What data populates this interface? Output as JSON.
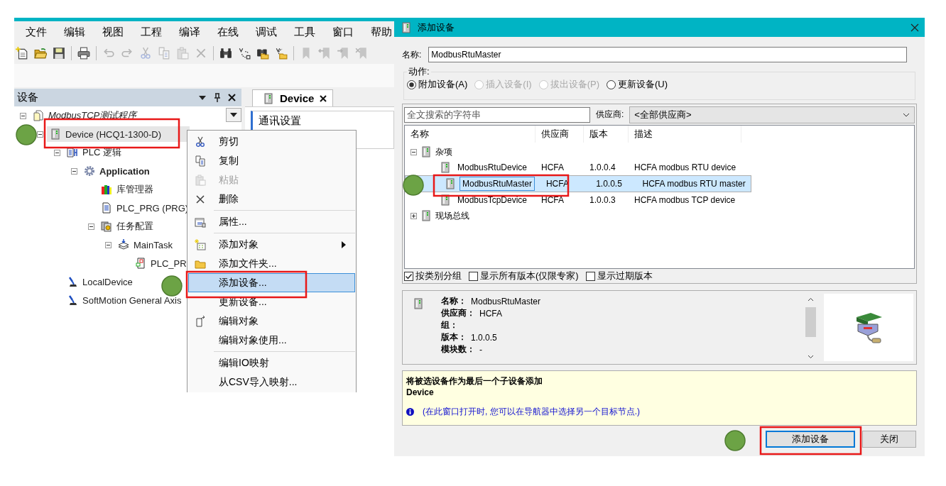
{
  "ide": {
    "menu": [
      "文件",
      "编辑",
      "视图",
      "工程",
      "编译",
      "在线",
      "调试",
      "工具",
      "窗口",
      "帮助"
    ],
    "toolbar": [
      {
        "kind": "new",
        "disabled": false
      },
      {
        "kind": "open",
        "disabled": false
      },
      {
        "kind": "save",
        "disabled": false
      },
      {
        "kind": "separator"
      },
      {
        "kind": "print",
        "disabled": false
      },
      {
        "kind": "separator"
      },
      {
        "kind": "undo",
        "disabled": true
      },
      {
        "kind": "redo",
        "disabled": true
      },
      {
        "kind": "cut",
        "disabled": true
      },
      {
        "kind": "copy",
        "disabled": true
      },
      {
        "kind": "paste",
        "disabled": true
      },
      {
        "kind": "delete",
        "disabled": true
      },
      {
        "kind": "separator"
      },
      {
        "kind": "find",
        "disabled": false
      },
      {
        "kind": "replace",
        "disabled": false
      },
      {
        "kind": "find-files",
        "disabled": false
      },
      {
        "kind": "replace-files",
        "disabled": false
      },
      {
        "kind": "separator"
      },
      {
        "kind": "bookmark",
        "disabled": true
      },
      {
        "kind": "bookmark-prev",
        "disabled": true
      },
      {
        "kind": "bookmark-next",
        "disabled": true
      },
      {
        "kind": "bookmark-clear",
        "disabled": true
      }
    ],
    "devices_pane": {
      "title": "设备",
      "tree": [
        {
          "kind": "project",
          "label": "ModbusTCP测试程序",
          "expanded": true,
          "selected": false,
          "children": [
            {
              "kind": "device",
              "label": "Device (HCQ1-1300-D)",
              "expanded": true,
              "selected": true,
              "children": [
                {
                  "kind": "plc-logic",
                  "label": "PLC 逻辑",
                  "expanded": true,
                  "selected": false,
                  "children": [
                    {
                      "kind": "application",
                      "label": "Application",
                      "expanded": true,
                      "selected": false,
                      "children": [
                        {
                          "kind": "library",
                          "label": "库管理器",
                          "selected": false
                        },
                        {
                          "kind": "pou",
                          "label": "PLC_PRG (PRG)",
                          "selected": false
                        },
                        {
                          "kind": "task-config",
                          "label": "任务配置",
                          "expanded": true,
                          "selected": false,
                          "children": [
                            {
                              "kind": "task",
                              "label": "MainTask",
                              "expanded": true,
                              "selected": false,
                              "children": [
                                {
                                  "kind": "task-call",
                                  "label": "PLC_PR",
                                  "selected": false
                                }
                              ]
                            }
                          ]
                        }
                      ]
                    }
                  ]
                },
                {
                  "kind": "axis",
                  "label": "LocalDevice",
                  "selected": false
                },
                {
                  "kind": "axis",
                  "label": "SoftMotion General Axis",
                  "selected": false
                }
              ]
            }
          ]
        }
      ]
    },
    "editor": {
      "tab": "Device",
      "heading": "通讯设置"
    },
    "context_menu": [
      {
        "kind": "cut",
        "label": "剪切",
        "disabled": false,
        "selected": false,
        "submenu": false
      },
      {
        "kind": "copy",
        "label": "复制",
        "disabled": false,
        "selected": false,
        "submenu": false
      },
      {
        "kind": "paste",
        "label": "粘贴",
        "disabled": true,
        "selected": false,
        "submenu": false
      },
      {
        "kind": "delete",
        "label": "删除",
        "disabled": false,
        "selected": false,
        "submenu": false
      },
      {
        "kind": "separator"
      },
      {
        "kind": "properties",
        "label": "属性...",
        "disabled": false,
        "selected": false,
        "submenu": false
      },
      {
        "kind": "separator"
      },
      {
        "kind": "add-object",
        "label": "添加对象",
        "disabled": false,
        "selected": false,
        "submenu": true
      },
      {
        "kind": "folder",
        "label": "添加文件夹...",
        "disabled": false,
        "selected": false,
        "submenu": false
      },
      {
        "kind": "plain",
        "label": "添加设备...",
        "disabled": false,
        "selected": true,
        "submenu": false
      },
      {
        "kind": "plain",
        "label": "更新设备...",
        "disabled": false,
        "selected": false,
        "submenu": false
      },
      {
        "kind": "edit-object",
        "label": "编辑对象",
        "disabled": false,
        "selected": false,
        "submenu": false
      },
      {
        "kind": "plain",
        "label": "编辑对象使用...",
        "disabled": false,
        "selected": false,
        "submenu": false
      },
      {
        "kind": "separator"
      },
      {
        "kind": "plain",
        "label": "编辑IO映射",
        "disabled": false,
        "selected": false,
        "submenu": false
      },
      {
        "kind": "plain",
        "label": "从CSV导入映射...",
        "disabled": false,
        "selected": false,
        "submenu": false
      }
    ]
  },
  "dialog": {
    "title": "添加设备",
    "name": {
      "label": "名称:",
      "value": "ModbusRtuMaster"
    },
    "action": {
      "label": "动作:",
      "options": [
        {
          "label": "附加设备(A)",
          "selected": true,
          "disabled": false
        },
        {
          "label": "插入设备(I)",
          "selected": false,
          "disabled": true
        },
        {
          "label": "拔出设备(P)",
          "selected": false,
          "disabled": true
        },
        {
          "label": "更新设备(U)",
          "selected": false,
          "disabled": false
        }
      ]
    },
    "search": {
      "placeholder": "全文搜索的字符串"
    },
    "vendor": {
      "label": "供应商:",
      "value": "<全部供应商>"
    },
    "table": {
      "columns": [
        "名称",
        "供应商",
        "版本",
        "描述"
      ],
      "rows": [
        {
          "kind": "category",
          "name": "杂项",
          "expanded": true,
          "selected": false,
          "children": [
            {
              "kind": "device",
              "name": "ModbusRtuDevice",
              "vendor": "HCFA",
              "version": "1.0.0.4",
              "description": "HCFA modbus RTU device",
              "selected": false
            },
            {
              "kind": "device",
              "name": "ModbusRtuMaster",
              "vendor": "HCFA",
              "version": "1.0.0.5",
              "description": "HCFA modbus RTU master",
              "selected": true
            },
            {
              "kind": "device",
              "name": "ModbusTcpDevice",
              "vendor": "HCFA",
              "version": "1.0.0.3",
              "description": "HCFA modbus TCP device",
              "selected": false
            }
          ]
        },
        {
          "kind": "category",
          "name": "现场总线",
          "expanded": false,
          "selected": false
        }
      ]
    },
    "options": [
      {
        "label": "按类别分组",
        "checked": true
      },
      {
        "label": "显示所有版本(仅限专家)",
        "checked": false
      },
      {
        "label": "显示过期版本",
        "checked": false
      }
    ],
    "details": [
      {
        "label": "名称：",
        "value": "ModbusRtuMaster"
      },
      {
        "label": "供应商：",
        "value": "HCFA"
      },
      {
        "label": "组："
      },
      {
        "label": "版本：",
        "value": "1.0.0.5"
      },
      {
        "label": "模块数：",
        "value": "-"
      }
    ],
    "info": {
      "title": "将被选设备作为最后一个子设备添加",
      "target": "Device",
      "hint": "(在此窗口打开时, 您可以在导航器中选择另一个目标节点.)"
    },
    "buttons": [
      {
        "label": "添加设备",
        "default": true
      },
      {
        "label": "关闭",
        "default": false
      }
    ]
  }
}
